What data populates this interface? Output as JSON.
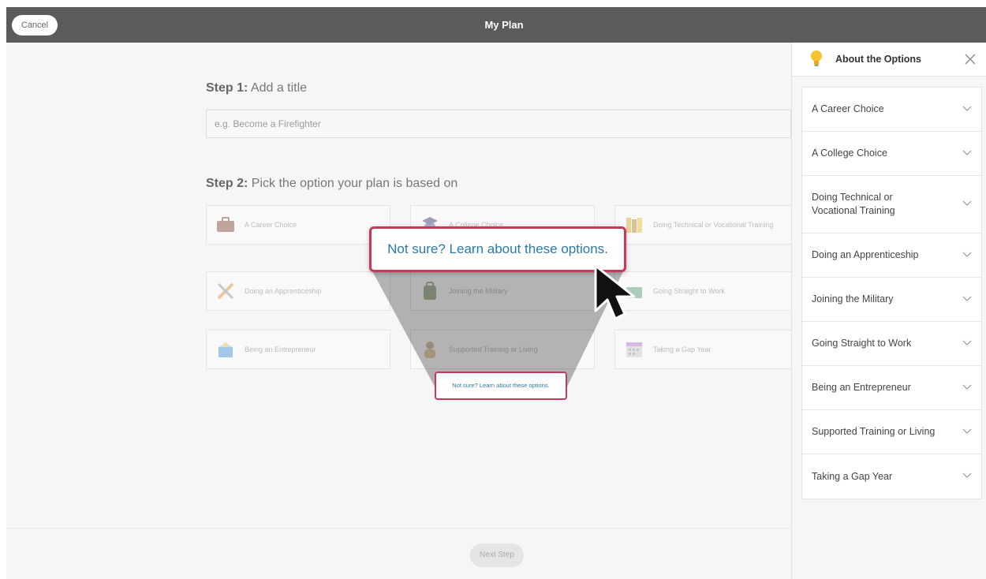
{
  "header": {
    "title": "My Plan",
    "cancel_label": "Cancel"
  },
  "step1": {
    "prefix": "Step 1:",
    "text": "Add a title",
    "placeholder": "e.g. Become a Firefighter"
  },
  "step2": {
    "prefix": "Step 2:",
    "text": "Pick the option your plan is based on"
  },
  "options": [
    {
      "label": "A Career Choice",
      "icon": "briefcase-icon"
    },
    {
      "label": "A College Choice",
      "icon": "graduation-icon"
    },
    {
      "label": "Doing Technical or Vocational Training",
      "icon": "books-icon"
    },
    {
      "label": "Doing an Apprenticeship",
      "icon": "tools-icon"
    },
    {
      "label": "Joining the Military",
      "icon": "backpack-icon"
    },
    {
      "label": "Going Straight to Work",
      "icon": "work-icon"
    },
    {
      "label": "Being an Entrepreneur",
      "icon": "package-icon"
    },
    {
      "label": "Supported Training or Living",
      "icon": "person-icon"
    },
    {
      "label": "Taking a Gap Year",
      "icon": "calendar-icon"
    }
  ],
  "callout": {
    "text": "Not sure? Learn about these options."
  },
  "footer": {
    "next_label": "Next Step"
  },
  "panel": {
    "title": "About the Options",
    "items": [
      "A Career Choice",
      "A College Choice",
      "Doing Technical or Vocational Training",
      "Doing an Apprenticeship",
      "Joining the Military",
      "Going Straight to Work",
      "Being an Entrepreneur",
      "Supported Training or Living",
      "Taking a Gap Year"
    ]
  },
  "colors": {
    "accent_red": "#c63a57",
    "link_blue": "#2a7aa9",
    "header_gray": "#5b5b5b"
  }
}
